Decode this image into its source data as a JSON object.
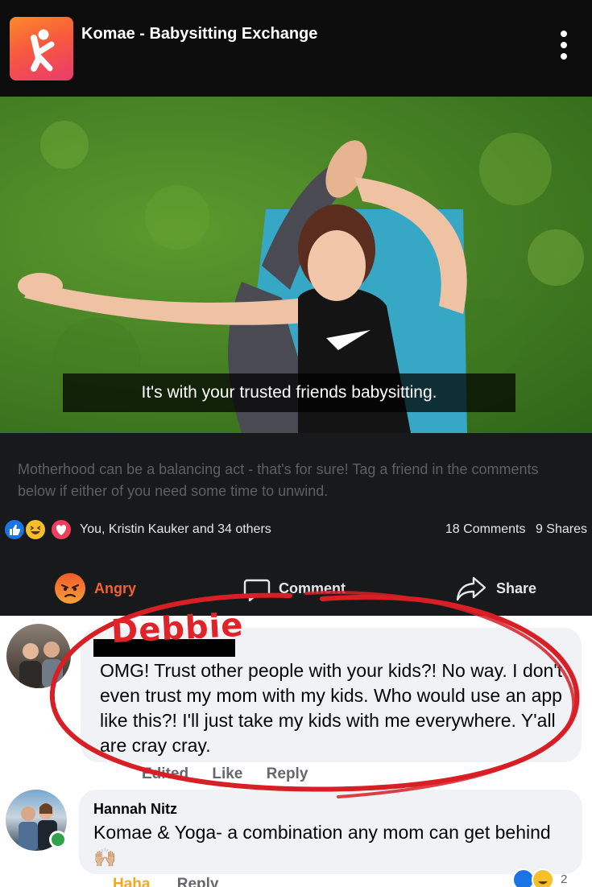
{
  "header": {
    "title": "Komae - Babysitting Exchange",
    "logo_icon": "komae-logo-icon",
    "menu_icon": "more-vertical-icon"
  },
  "video": {
    "caption": "It's with your trusted friends babysitting."
  },
  "post": {
    "text": "Motherhood can be a balancing act - that's for sure! Tag a friend in the comments below if either of you need some time to unwind.",
    "reactions_summary": "You, Kristin Kauker and 34 others",
    "comments_count": "18 Comments",
    "shares_count": "9 Shares",
    "actions": {
      "reaction_label": "Angry",
      "comment_label": "Comment",
      "share_label": "Share"
    }
  },
  "comments": [
    {
      "author_annotation": "Debbie",
      "text": "OMG! Trust other people with your kids?! No way. I don't even trust my mom with my kids. Who would use an app like this?! I'll just take my kids with me everywhere. Y'all are cray cray.",
      "edited_label": "Edited",
      "like_label": "Like",
      "reply_label": "Reply"
    },
    {
      "author": "Hannah Nitz",
      "text": "Komae & Yoga- a combination any mom can get behind 🙌🏼",
      "reaction_label": "Haha",
      "reply_label": "Reply",
      "reaction_count": "2"
    }
  ],
  "colors": {
    "header_bg": "#0c0c0d",
    "post_bg": "#18191a",
    "angry_accent": "#f3632f",
    "annotation_red": "#e02329",
    "like_blue": "#1b74e4",
    "online_green": "#31a24c"
  }
}
